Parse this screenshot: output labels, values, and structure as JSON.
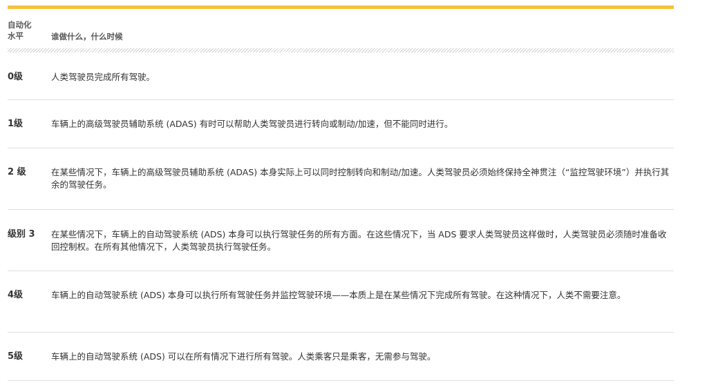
{
  "table": {
    "header": {
      "level_col": "自动化\n水平",
      "desc_col": "谁做什么，什么时候"
    },
    "rows": [
      {
        "level": "0级",
        "desc": "人类驾驶员完成所有驾驶。"
      },
      {
        "level": "1级",
        "desc": "车辆上的高级驾驶员辅助系统 (ADAS) 有时可以帮助人类驾驶员进行转向或制动/加速，但不能同时进行。"
      },
      {
        "level": "2 级",
        "desc": "在某些情况下，车辆上的高级驾驶员辅助系统 (ADAS) 本身实际上可以同时控制转向和制动/加速。人类驾驶员必须始终保持全神贯注（“监控驾驶环境”）并执行其余的驾驶任务。"
      },
      {
        "level": "级别 3",
        "desc": "在某些情况下，车辆上的自动驾驶系统 (ADS) 本身可以执行驾驶任务的所有方面。在这些情况下，当 ADS 要求人类驾驶员这样做时，人类驾驶员必须随时准备收回控制权。在所有其他情况下，人类驾驶员执行驾驶任务。"
      },
      {
        "level": "4级",
        "desc": "车辆上的自动驾驶系统 (ADS) 本身可以执行所有驾驶任务并监控驾驶环境——本质上是在某些情况下完成所有驾驶。在这种情况下，人类不需要注意。"
      },
      {
        "level": "5级",
        "desc": "车辆上的自动驾驶系统 (ADS) 可以在所有情况下进行所有驾驶。人类乘客只是乘客，无需参与驾驶。"
      }
    ],
    "colors": {
      "accent": "#f5c13c",
      "divider": "#e0e0e0",
      "text": "#333333"
    }
  }
}
